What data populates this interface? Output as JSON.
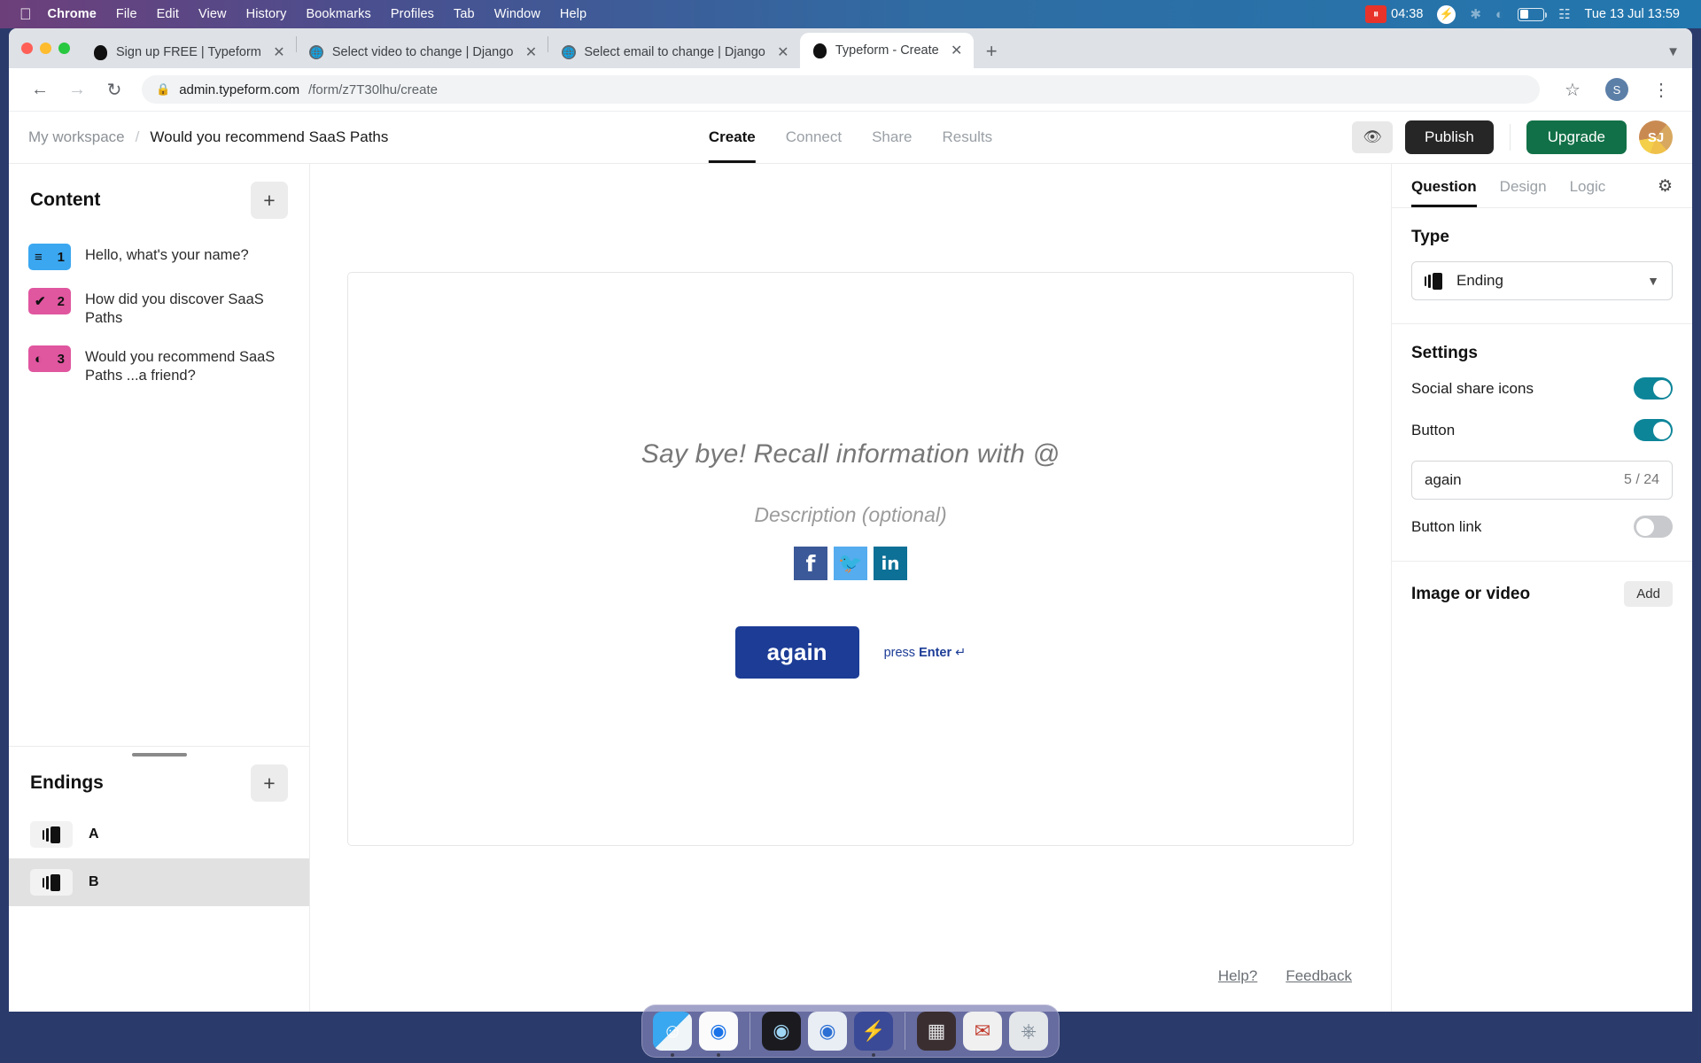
{
  "menubar": {
    "apple": "apple-logo",
    "items": [
      "Chrome",
      "File",
      "Edit",
      "View",
      "History",
      "Bookmarks",
      "Profiles",
      "Tab",
      "Window",
      "Help"
    ],
    "recording_time": "04:38",
    "clock": "Tue 13 Jul  13:59"
  },
  "browser": {
    "tabs": [
      {
        "title": "Sign up FREE | Typeform",
        "favicon": "typeform-favicon",
        "active": false
      },
      {
        "title": "Select video to change | Django",
        "favicon": "django-globe-favicon",
        "active": false
      },
      {
        "title": "Select email to change | Django",
        "favicon": "django-globe-favicon",
        "active": false
      },
      {
        "title": "Typeform - Create",
        "favicon": "typeform-favicon",
        "active": true
      }
    ],
    "tab_close_label": "✕",
    "new_tab_label": "+",
    "url_host": "admin.typeform.com",
    "url_path": "/form/z7T30lhu/create",
    "profile_initial": "S"
  },
  "app": {
    "breadcrumb": {
      "workspace": "My workspace",
      "separator": "/",
      "title": "Would you recommend SaaS Paths"
    },
    "tabs": [
      {
        "label": "Create",
        "active": true
      },
      {
        "label": "Connect",
        "active": false
      },
      {
        "label": "Share",
        "active": false
      },
      {
        "label": "Results",
        "active": false
      }
    ],
    "preview_icon": "eye-icon",
    "publish_label": "Publish",
    "upgrade_label": "Upgrade",
    "avatar_initials": "SJ"
  },
  "sidebar": {
    "content_heading": "Content",
    "add_label": "+",
    "questions": [
      {
        "number": "1",
        "label": "Hello, what's your name?",
        "color": "blue",
        "glyph": "≡",
        "icon": "short-text-icon"
      },
      {
        "number": "2",
        "label": "How did you discover SaaS Paths",
        "color": "pink",
        "glyph": "✔",
        "icon": "multiple-choice-icon"
      },
      {
        "number": "3",
        "label": "Would you recommend SaaS Paths ...a friend?",
        "color": "pink",
        "glyph": "◐",
        "icon": "opinion-scale-icon"
      }
    ],
    "endings_heading": "Endings",
    "endings": [
      {
        "letter": "A",
        "selected": false
      },
      {
        "letter": "B",
        "selected": true
      }
    ]
  },
  "canvas": {
    "title": "Say bye! Recall information with @",
    "description": "Description (optional)",
    "socials": [
      {
        "name": "facebook-icon",
        "glyph": "f",
        "color": "#3b5998"
      },
      {
        "name": "twitter-icon",
        "glyph": "🐦",
        "color": "#55acee"
      },
      {
        "name": "linkedin-icon",
        "glyph": "in",
        "color": "#0d7096"
      }
    ],
    "button_label": "again",
    "press_enter_prefix": "press ",
    "press_enter_key": "Enter",
    "press_enter_symbol": " ↵",
    "help_label": "Help?",
    "feedback_label": "Feedback"
  },
  "rightpanel": {
    "tabs": [
      {
        "label": "Question",
        "active": true
      },
      {
        "label": "Design",
        "active": false
      },
      {
        "label": "Logic",
        "active": false
      }
    ],
    "settings_icon": "gear-icon",
    "type_heading": "Type",
    "type_value": "Ending",
    "type_chevron": "⌄",
    "settings_heading": "Settings",
    "social_share_label": "Social share icons",
    "social_share_on": true,
    "button_label": "Button",
    "button_on": true,
    "button_text_value": "again",
    "button_text_count": "5 / 24",
    "button_link_label": "Button link",
    "button_link_on": false,
    "image_or_video_label": "Image or video",
    "add_label": "Add"
  },
  "dock": {
    "items": [
      {
        "name": "finder-icon",
        "glyph": "👤",
        "color": "#3aa0ec",
        "running": true
      },
      {
        "name": "chrome-icon",
        "glyph": "◉",
        "color": "#f5f5f5",
        "running": true
      },
      {
        "name": "quicktime-icon",
        "glyph": "◎",
        "color": "#1c1c1e",
        "running": false
      },
      {
        "name": "1password-icon",
        "glyph": "ⓘ",
        "color": "#2b6fd4",
        "running": false
      },
      {
        "name": "flash-icon",
        "glyph": "⚡",
        "color": "#3d4a8c",
        "running": true
      },
      {
        "name": "app-store-icon",
        "glyph": "▤",
        "color": "#3a2f33",
        "running": false
      },
      {
        "name": "mail-icon",
        "glyph": "✉",
        "color": "#e8e8e8",
        "running": false
      },
      {
        "name": "trash-icon",
        "glyph": "🗑",
        "color": "#dfe3e8",
        "running": false
      }
    ]
  },
  "colors": {
    "accent_teal": "#0d8599",
    "publish_dark": "#262627",
    "upgrade_green": "#117047",
    "cta_blue": "#1c3c96",
    "badge_blue": "#3ba7f0",
    "badge_pink": "#e0569f"
  }
}
